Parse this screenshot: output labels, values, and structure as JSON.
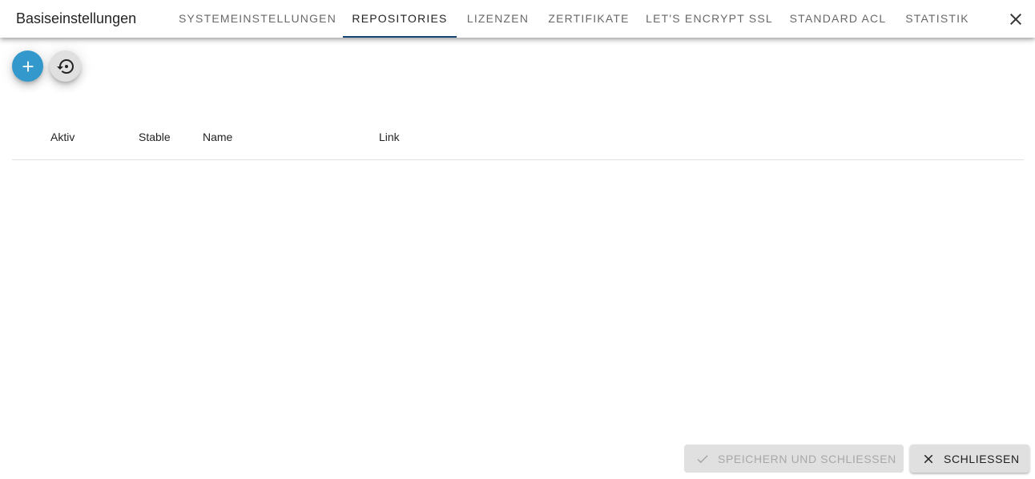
{
  "dialog": {
    "title": "Basiseinstellungen"
  },
  "tabs": [
    {
      "label": "Systemeinstellungen"
    },
    {
      "label": "Repositories"
    },
    {
      "label": "Lizenzen"
    },
    {
      "label": "Zertifikate"
    },
    {
      "label": "Let's Encrypt SSL"
    },
    {
      "label": "Standard ACL"
    },
    {
      "label": "Statistik"
    }
  ],
  "active_tab": "Repositories",
  "toolbar": {
    "add_icon": "plus-icon",
    "restore_icon": "restore-history-icon"
  },
  "table": {
    "columns": [
      "Aktiv",
      "Stable",
      "Name",
      "Link"
    ],
    "rows": []
  },
  "footer": {
    "save_label": "Speichern und schließen",
    "close_label": "Schließen"
  },
  "colors": {
    "accent": "#3399cc",
    "tab_indicator": "#164477"
  }
}
